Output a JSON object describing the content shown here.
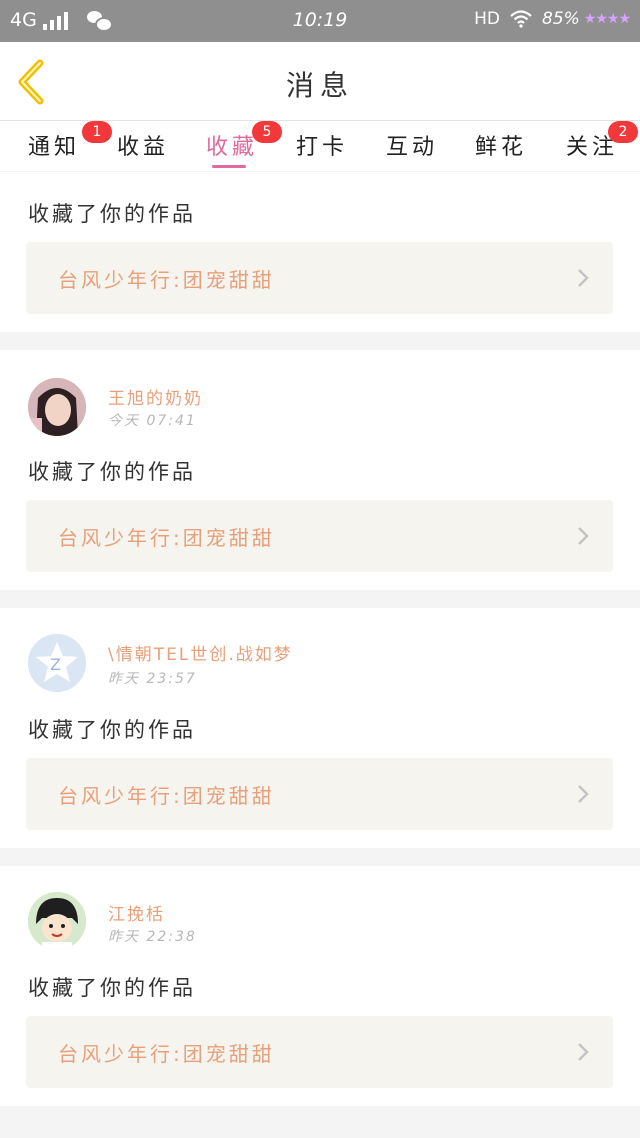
{
  "status_bar": {
    "network": "4G",
    "time": "10:19",
    "hd": "HD",
    "battery": "85%",
    "stars": "★★★★"
  },
  "header": {
    "title": "消息",
    "back_icon": "chevron-left-icon",
    "accent": "#f0c000"
  },
  "tabs": [
    {
      "label": "通知",
      "badge": "1"
    },
    {
      "label": "收益",
      "badge": ""
    },
    {
      "label": "收藏",
      "badge": "5",
      "active": true
    },
    {
      "label": "打卡",
      "badge": ""
    },
    {
      "label": "互动",
      "badge": ""
    },
    {
      "label": "鲜花",
      "badge": ""
    },
    {
      "label": "关注",
      "badge": "2"
    }
  ],
  "messages": [
    {
      "action": "收藏了你的作品",
      "work": "台风少年行:团宠甜甜"
    },
    {
      "name": "王旭的奶奶",
      "time": "今天 07:41",
      "action": "收藏了你的作品",
      "work": "台风少年行:团宠甜甜"
    },
    {
      "name": "\\情朝TEL世创.战如梦",
      "time": "昨天 23:57",
      "action": "收藏了你的作品",
      "work": "台风少年行:团宠甜甜"
    },
    {
      "name": "江挽栝",
      "time": "昨天 22:38",
      "action": "收藏了你的作品",
      "work": "台风少年行:团宠甜甜"
    }
  ],
  "colors": {
    "active_tab": "#e06a9e",
    "badge": "#f1393b",
    "name": "#e8a07a",
    "work_bg": "#f5f4ef"
  }
}
